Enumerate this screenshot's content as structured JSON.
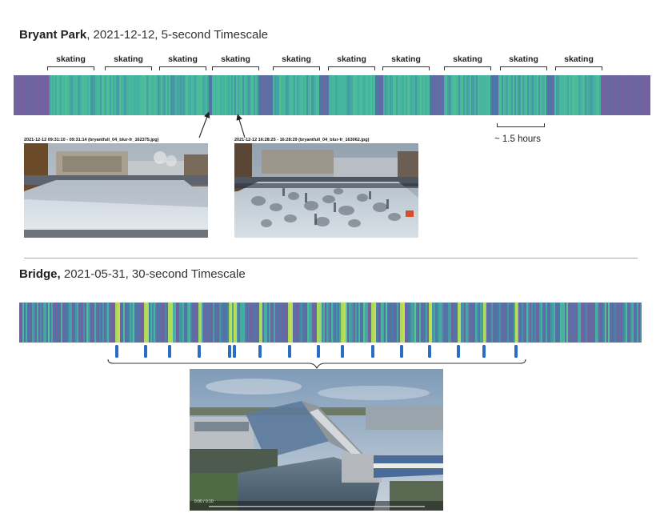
{
  "panel1": {
    "title_bold": "Bryant Park",
    "title_rest": ", 2021-12-12, 5-second Timescale",
    "segment_label": "skating",
    "duration_label": "~ 1.5 hours",
    "caption_left": "2021-12-12 09:31:10 - 09:31:14   (bryantfull_04_blur-fr_162375.jpg)",
    "caption_right": "2021-12-12 16:28:25 - 16:28:29   (bryantfull_04_blur-fr_163062.jpg)"
  },
  "panel2": {
    "title_bold": "Bridge,",
    "title_rest": " 2021-05-31, 30-second Timescale",
    "player_time": "0:00 / 0:10"
  },
  "colors": {
    "purple": "#7a5e9e",
    "blue": "#4a78a8",
    "teal": "#44b4a0",
    "green": "#58c890",
    "yellow": "#c8e050",
    "marker": "#2b6cc4"
  }
}
